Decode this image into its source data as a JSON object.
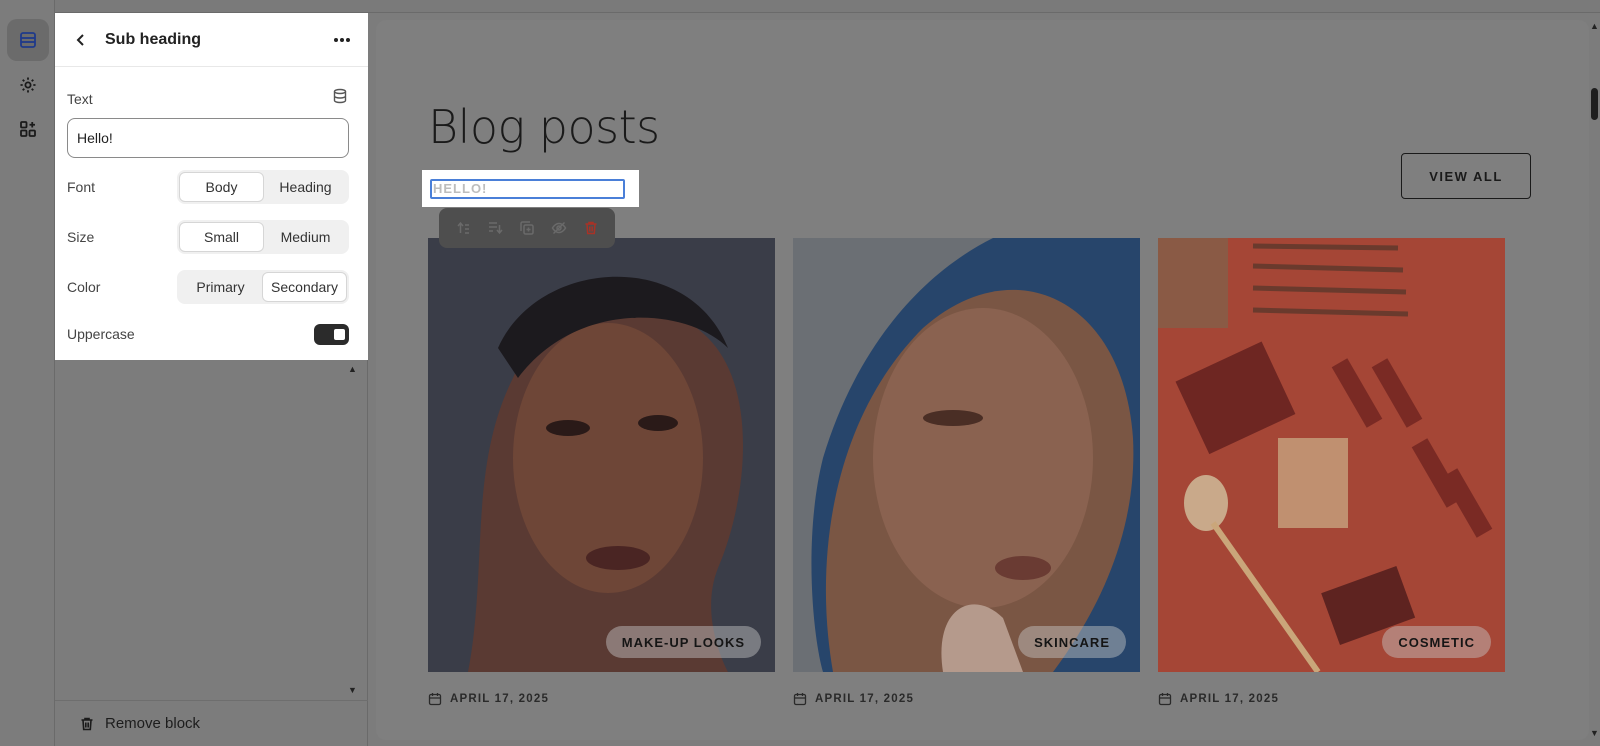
{
  "rail": {
    "items": [
      {
        "icon": "sections-icon",
        "active": true
      },
      {
        "icon": "gear-icon",
        "active": false
      },
      {
        "icon": "apps-icon",
        "active": false
      }
    ]
  },
  "panel": {
    "title": "Sub heading",
    "text_label": "Text",
    "text_value": "Hello!",
    "font_label": "Font",
    "font_options": [
      "Body",
      "Heading"
    ],
    "font_selected": "Body",
    "size_label": "Size",
    "size_options": [
      "Small",
      "Medium"
    ],
    "size_selected": "Small",
    "color_label": "Color",
    "color_options": [
      "Primary",
      "Secondary"
    ],
    "color_selected": "Secondary",
    "uppercase_label": "Uppercase",
    "uppercase_on": true,
    "remove_label": "Remove block"
  },
  "preview": {
    "title": "Blog posts",
    "subheading_value": "HELLO!",
    "view_all": "VIEW ALL",
    "cards": [
      {
        "tag": "MAKE-UP LOOKS",
        "date": "APRIL 17, 2025"
      },
      {
        "tag": "SKINCARE",
        "date": "APRIL 17, 2025"
      },
      {
        "tag": "COSMETIC",
        "date": "APRIL 17, 2025"
      }
    ]
  },
  "colors": {
    "accent": "#4a7fd8",
    "delete": "#c0392b",
    "overlay": "#7c7c7c"
  }
}
